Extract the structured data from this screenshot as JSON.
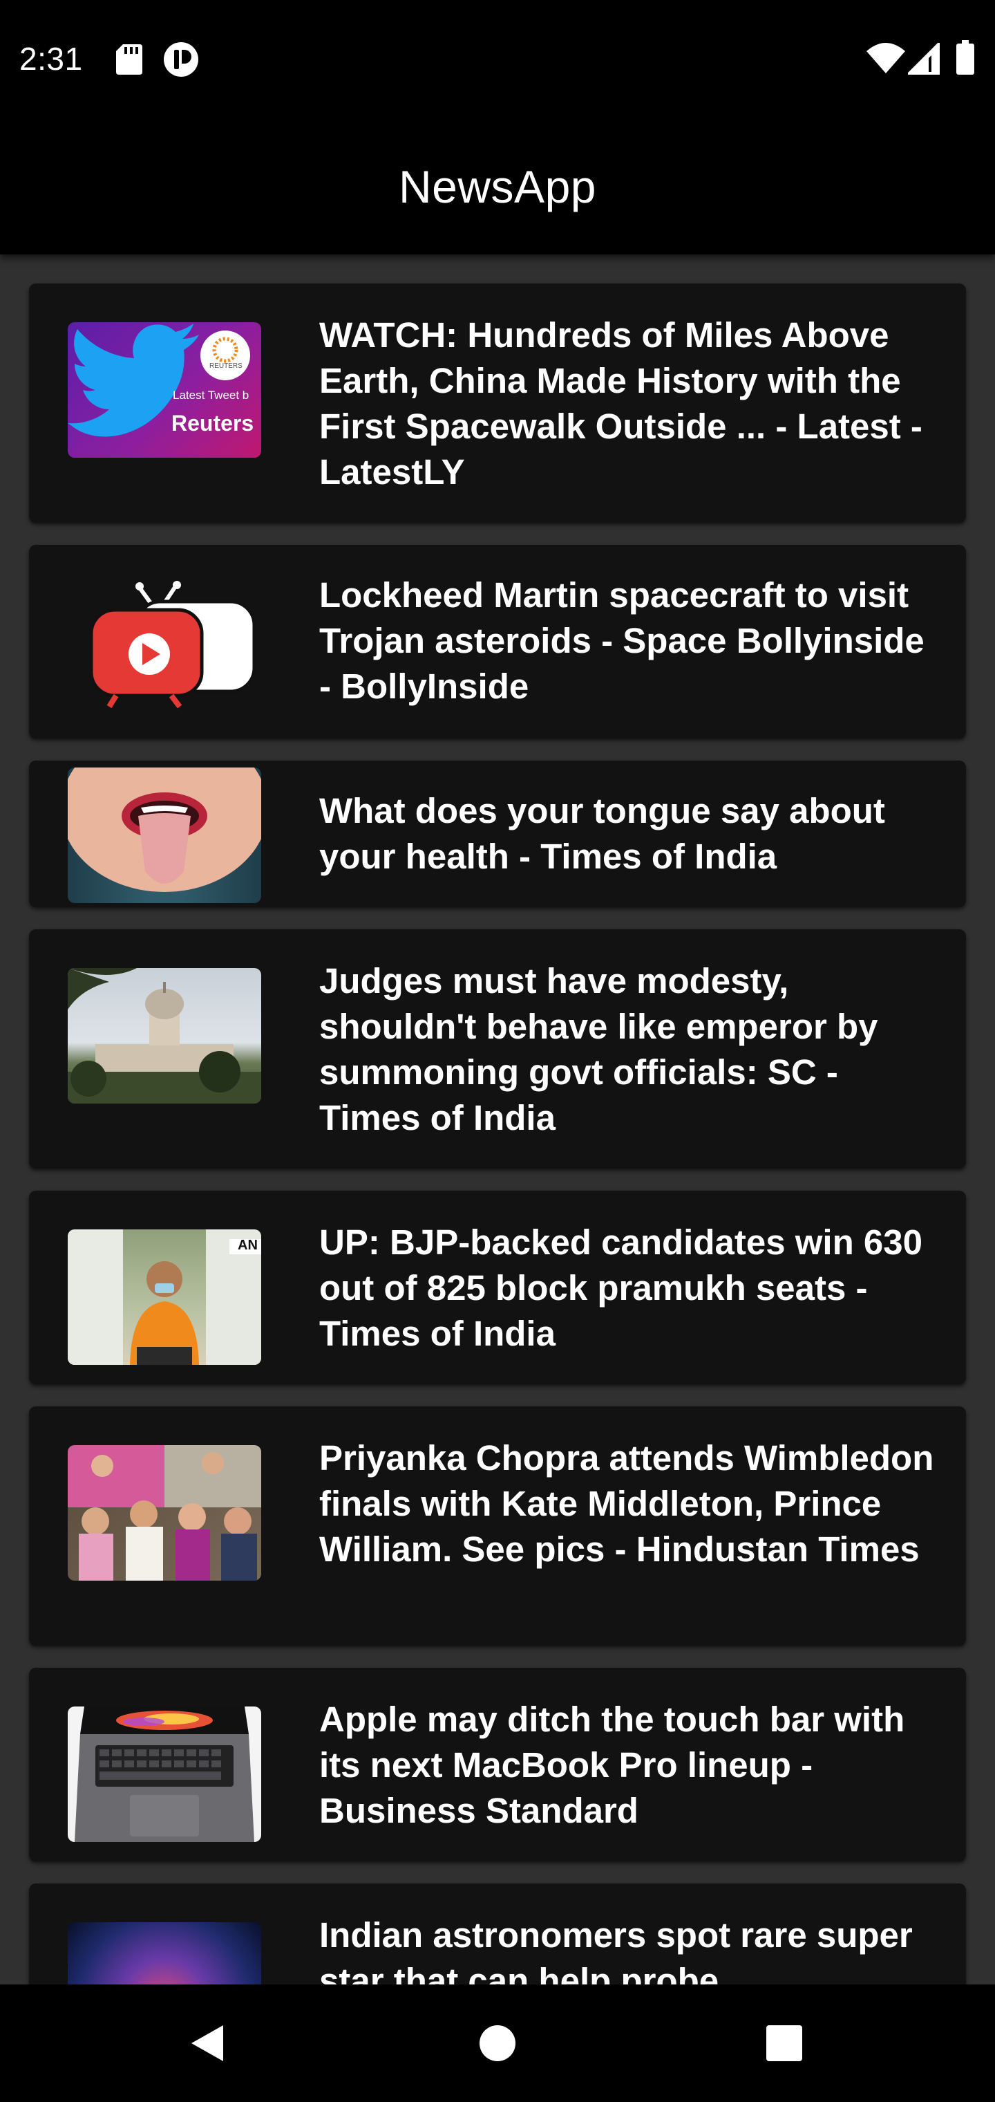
{
  "status_bar": {
    "time": "2:31",
    "icons_left": [
      "sd-card-icon",
      "accessibility-icon"
    ],
    "icons_right": [
      "wifi-icon",
      "cellular-signal-icon",
      "battery-icon"
    ]
  },
  "app_bar": {
    "title": "NewsApp"
  },
  "articles": [
    {
      "headline": "WATCH: Hundreds of Miles Above Earth, China Made History with the First Spacewalk Outside ... - Latest - LatestLY",
      "thumb_text_1": "Latest Tweet b",
      "thumb_text_2": "Reuters",
      "thumb_badge": "REUTERS"
    },
    {
      "headline": "Lockheed Martin spacecraft to visit Trojan asteroids - Space Bollyinside - BollyInside"
    },
    {
      "headline": "What does your tongue say about your health - Times of India"
    },
    {
      "headline": "Judges must have modesty, shouldn't behave like emperor by summoning govt officials: SC - Times of India"
    },
    {
      "headline": "UP: BJP-backed candidates win 630 out of 825 block pramukh seats - Times of India",
      "thumb_badge": "AN"
    },
    {
      "headline": "Priyanka Chopra attends Wimbledon finals with Kate Middleton, Prince William. See pics - Hindustan Times"
    },
    {
      "headline": "Apple may ditch the touch bar with its next MacBook Pro lineup - Business Standard"
    },
    {
      "headline": "Indian astronomers spot rare super star that can help probe"
    }
  ],
  "nav_bar": {
    "buttons": [
      "back-icon",
      "home-icon",
      "recents-icon"
    ]
  },
  "colors": {
    "background": "#303030",
    "card": "#121212",
    "bars": "#000000",
    "text": "#ffffff"
  }
}
